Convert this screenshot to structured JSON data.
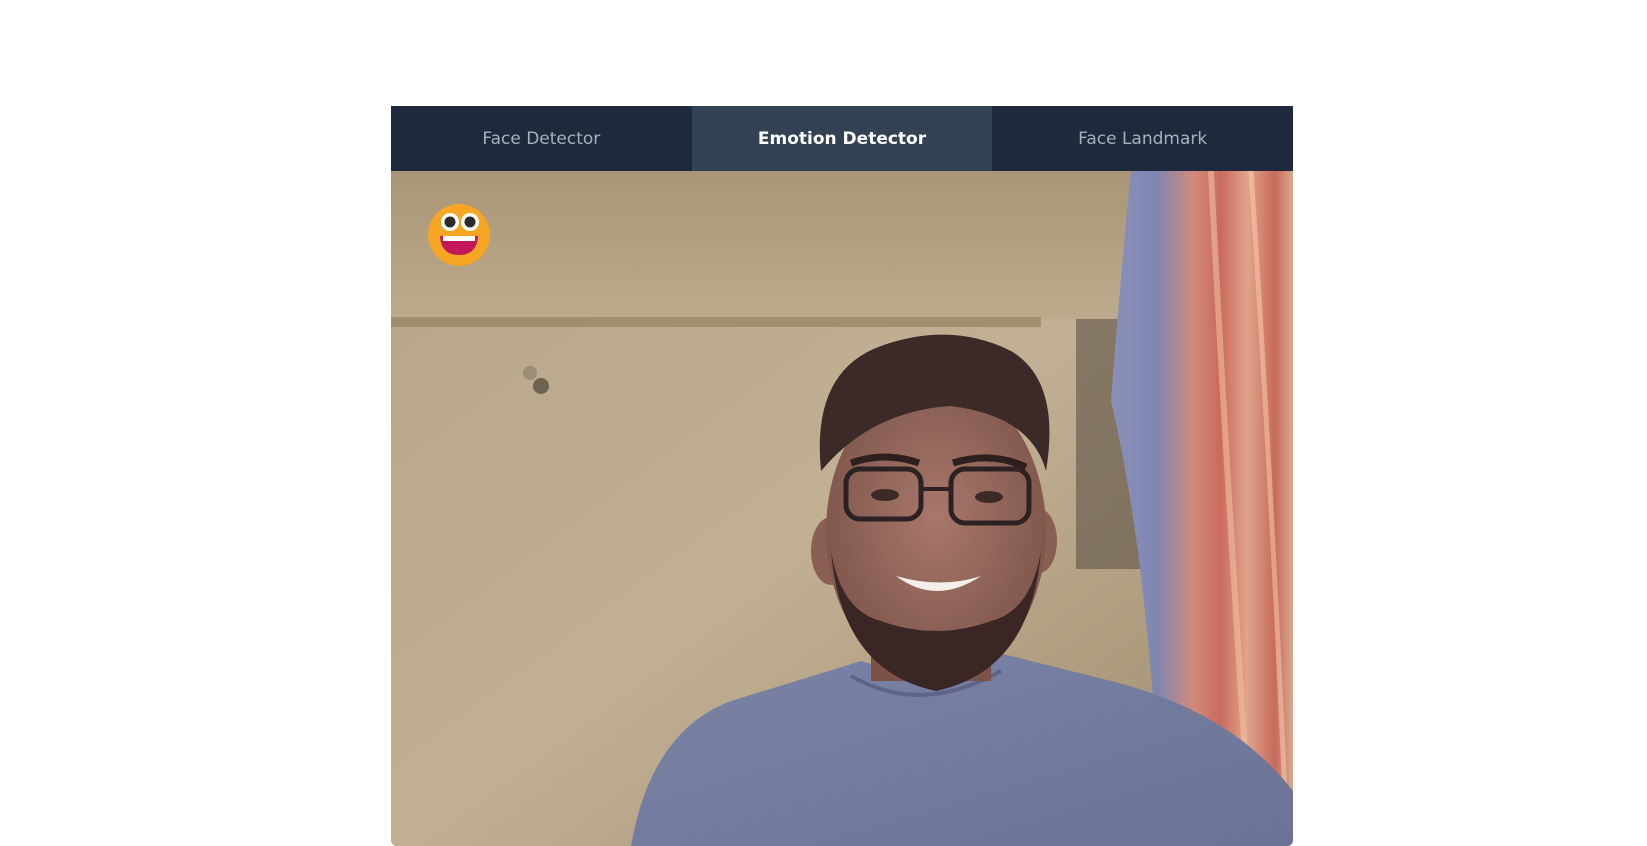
{
  "header": {
    "caption": ""
  },
  "tabs": [
    {
      "label": "Face Detector",
      "active": false
    },
    {
      "label": "Emotion Detector",
      "active": true
    },
    {
      "label": "Face Landmark",
      "active": false
    }
  ],
  "video": {
    "detected_emotion_icon": "grinning-face-icon"
  },
  "colors": {
    "tab_bar": "#1e293b",
    "tab_active": "#334155",
    "tab_text": "#a8b0bc",
    "tab_text_active": "#ffffff",
    "emoji_face": "#f6a623",
    "emoji_mouth": "#c2185b"
  }
}
